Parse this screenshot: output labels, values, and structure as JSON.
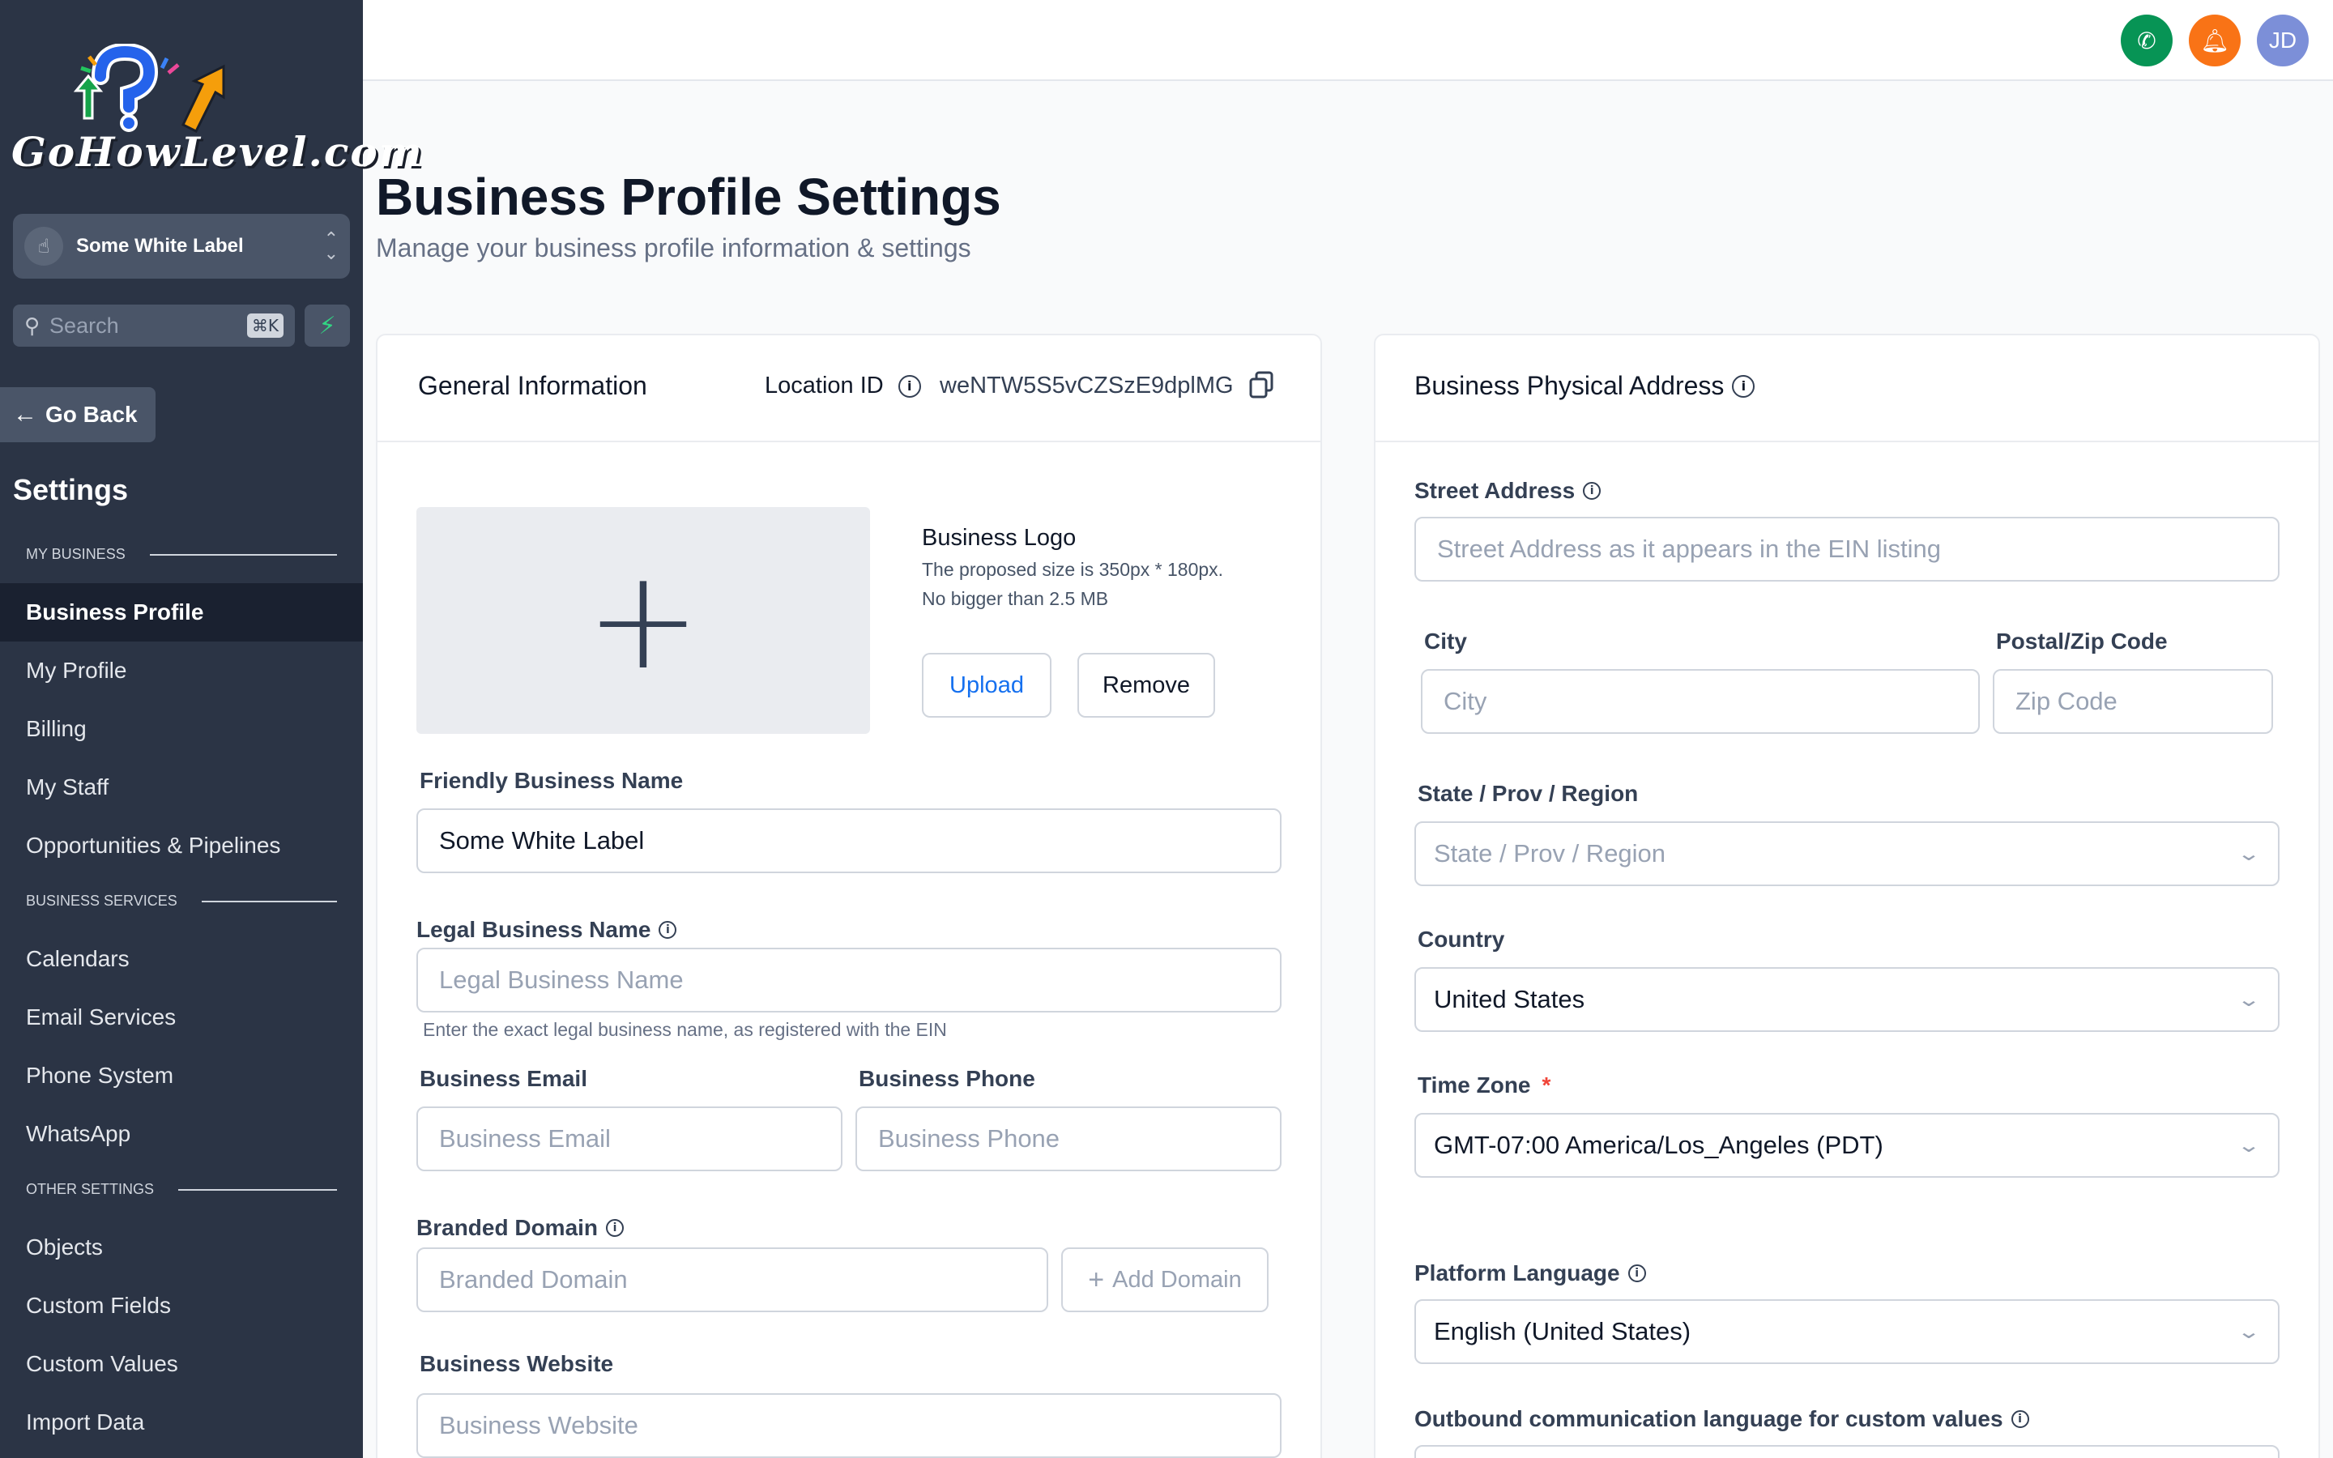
{
  "sidebar": {
    "logo_text": "GoHowLevel.com",
    "workspace": {
      "name": "Some White Label"
    },
    "search": {
      "placeholder": "Search",
      "shortcut": "⌘K"
    },
    "go_back": "Go Back",
    "settings_title": "Settings",
    "sections": [
      {
        "heading": "MY BUSINESS",
        "items": [
          "Business Profile",
          "My Profile",
          "Billing",
          "My Staff",
          "Opportunities & Pipelines"
        ]
      },
      {
        "heading": "BUSINESS SERVICES",
        "items": [
          "Calendars",
          "Email Services",
          "Phone System",
          "WhatsApp"
        ]
      },
      {
        "heading": "OTHER SETTINGS",
        "items": [
          "Objects",
          "Custom Fields",
          "Custom Values",
          "Import Data"
        ]
      }
    ],
    "active_item": "Business Profile"
  },
  "topbar": {
    "avatar_initials": "JD",
    "icons": [
      "phone-icon",
      "bell-icon"
    ]
  },
  "page": {
    "title": "Business Profile Settings",
    "subtitle": "Manage your business profile information & settings"
  },
  "general": {
    "title": "General Information",
    "location_label": "Location ID",
    "location_id": "weNTW5S5vCZSzE9dplMG",
    "logo_label": "Business Logo",
    "logo_hint_1": "The proposed size is 350px * 180px.",
    "logo_hint_2": "No bigger than 2.5 MB",
    "upload": "Upload",
    "remove": "Remove",
    "friendly_label": "Friendly Business Name",
    "friendly_value": "Some White Label",
    "legal_label": "Legal Business Name",
    "legal_placeholder": "Legal Business Name",
    "legal_helper": "Enter the exact legal business name, as registered with the EIN",
    "email_label": "Business Email",
    "email_placeholder": "Business Email",
    "phone_label": "Business Phone",
    "phone_placeholder": "Business Phone",
    "domain_label": "Branded Domain",
    "domain_placeholder": "Branded Domain",
    "add_domain": "Add Domain",
    "website_label": "Business Website",
    "website_placeholder": "Business Website"
  },
  "address": {
    "title": "Business Physical Address",
    "street_label": "Street Address",
    "street_placeholder": "Street Address as it appears in the EIN listing",
    "city_label": "City",
    "city_placeholder": "City",
    "zip_label": "Postal/Zip Code",
    "zip_placeholder": "Zip Code",
    "state_label": "State / Prov / Region",
    "state_placeholder": "State / Prov / Region",
    "country_label": "Country",
    "country_value": "United States",
    "timezone_label": "Time Zone",
    "timezone_required": "*",
    "timezone_value": "GMT-07:00 America/Los_Angeles (PDT)",
    "language_label": "Platform Language",
    "language_value": "English (United States)",
    "outbound_label": "Outbound communication language for custom values"
  },
  "colors": {
    "sidebar": "#2b3445",
    "active": "#1a2130",
    "accent": "#1570ef",
    "phone": "#079455",
    "bell": "#f97316",
    "avatar": "#7c8fd8"
  }
}
